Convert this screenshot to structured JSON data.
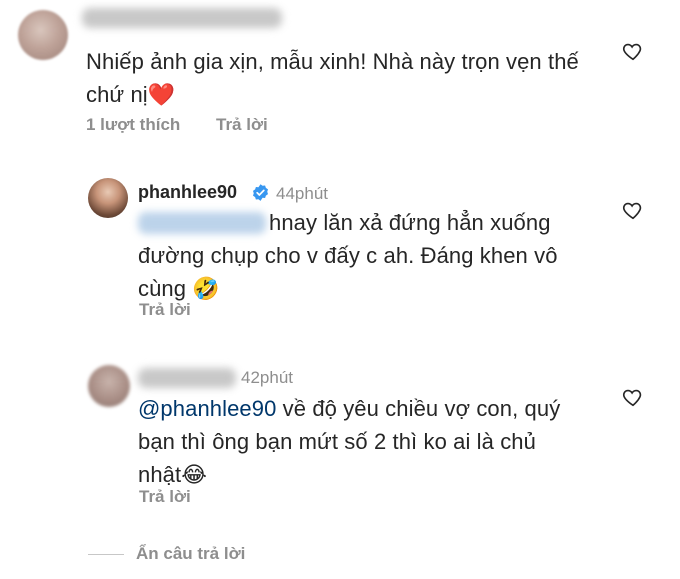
{
  "comment": {
    "text": "Nhiếp ảnh gia xịn, mẫu xinh! Nhà này trọn vẹn thế chứ nị",
    "emoji": "❤️",
    "likes": "1 lượt thích",
    "reply_label": "Trả lời"
  },
  "replies": [
    {
      "username": "phanhlee90",
      "verified": true,
      "time": "44phút",
      "text_line1": "hnay lăn xả đứng hẳn xuống",
      "text_line2": "đường chụp cho v đấy c ah. Đáng khen vô",
      "text_line3": "cùng",
      "emoji": "🤣",
      "reply_label": "Trả lời"
    },
    {
      "time": "42phút",
      "mention": "@phanhlee90",
      "text_line1": " về độ yêu chiều vợ con, quý",
      "text_line2": "bạn thì ông bạn mứt số 2 thì ko ai là chủ",
      "text_line3": "nhật",
      "emoji": "😂",
      "reply_label": "Trả lời"
    }
  ],
  "hide_replies_label": "Ẩn câu trả lời",
  "icons": {
    "like": "heart-outline-icon",
    "verified": "verified-badge-icon"
  },
  "colors": {
    "text": "#262626",
    "muted": "#8e8e8e",
    "mention": "#00376b",
    "verified": "#3897f0",
    "heart": "#e0245e"
  }
}
